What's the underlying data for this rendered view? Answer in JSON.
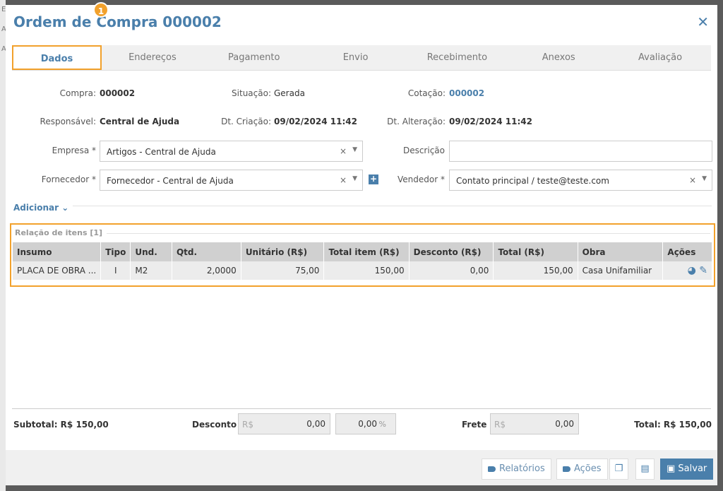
{
  "background_letters": [
    "E",
    "A",
    "A"
  ],
  "modal": {
    "title": "Ordem de Compra 000002",
    "close_icon": "close-icon"
  },
  "tabs": [
    {
      "label": "Dados",
      "active": true
    },
    {
      "label": "Endereços"
    },
    {
      "label": "Pagamento"
    },
    {
      "label": "Envio"
    },
    {
      "label": "Recebimento"
    },
    {
      "label": "Anexos"
    },
    {
      "label": "Avaliação"
    }
  ],
  "tab_badge": "1",
  "info": {
    "compra_label": "Compra:",
    "compra_value": "000002",
    "situacao_label": "Situação:",
    "situacao_value": "Gerada",
    "cotacao_label": "Cotação:",
    "cotacao_value": "000002",
    "responsavel_label": "Responsável:",
    "responsavel_value": "Central de Ajuda",
    "dtcriacao_label": "Dt. Criação:",
    "dtcriacao_value": "09/02/2024 11:42",
    "dtalteracao_label": "Dt. Alteração:",
    "dtalteracao_value": "09/02/2024 11:42"
  },
  "form": {
    "empresa_label": "Empresa *",
    "empresa_value": "Artigos - Central de Ajuda",
    "descricao_label": "Descrição",
    "descricao_value": "",
    "fornecedor_label": "Fornecedor *",
    "fornecedor_value": "Fornecedor - Central de Ajuda",
    "vendedor_label": "Vendedor *",
    "vendedor_value": "Contato principal / teste@teste.com",
    "clear_glyph": "×",
    "arrow_glyph": "▼"
  },
  "adicionar_label": "Adicionar",
  "items": {
    "title": "Relação de itens [1]",
    "columns": [
      "Insumo",
      "Tipo",
      "Und.",
      "Qtd.",
      "Unitário (R$)",
      "Total item (R$)",
      "Desconto (R$)",
      "Total (R$)",
      "Obra",
      "Ações"
    ],
    "rows": [
      [
        "PLACA DE OBRA ...",
        "I",
        "M2",
        "2,0000",
        "75,00",
        "150,00",
        "0,00",
        "150,00",
        "Casa Unifamiliar",
        ""
      ]
    ]
  },
  "footer": {
    "subtotal": "Subtotal: R$ 150,00",
    "desconto_label": "Desconto",
    "currency_prefix": "R$",
    "desconto_value": "0,00",
    "desconto_pct": "0,00",
    "pct_suffix": "%",
    "frete_label": "Frete",
    "frete_value": "0,00",
    "total": "Total: R$ 150,00"
  },
  "buttons": {
    "relatorios": "Relatórios",
    "acoes": "Ações",
    "salvar": "Salvar"
  }
}
